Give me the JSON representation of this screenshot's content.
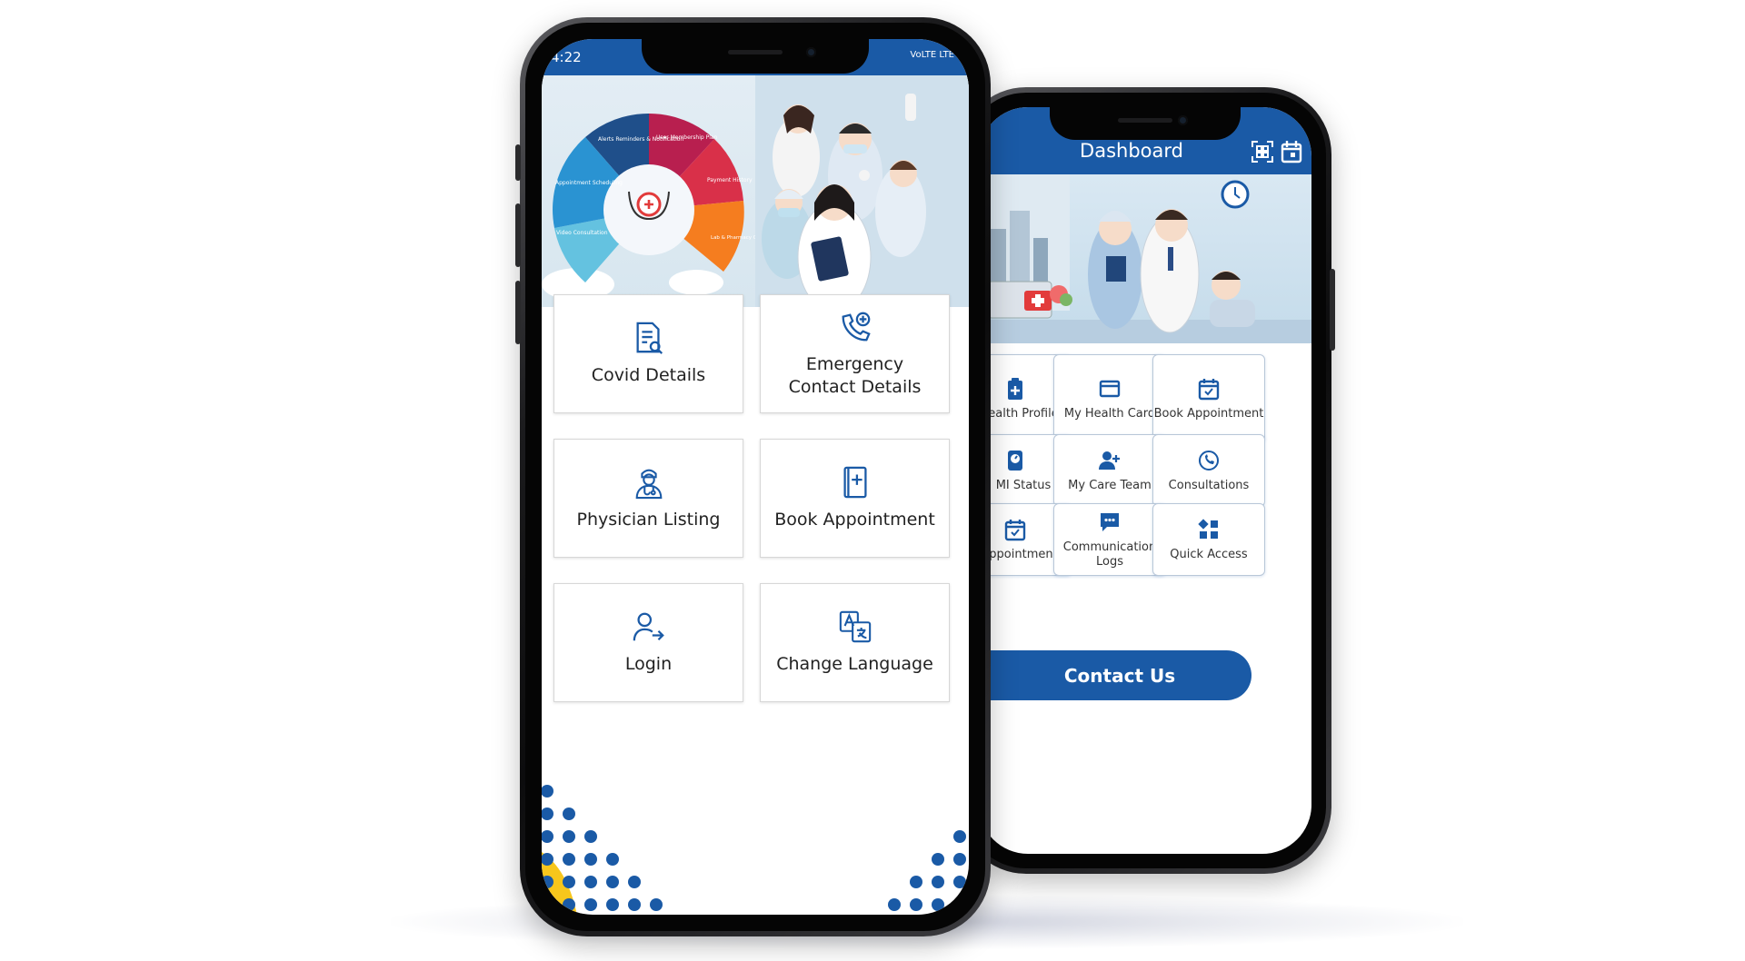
{
  "colors": {
    "primary": "#1a5aa6",
    "tile_border": "#d7d7d7",
    "accent_yellow": "#f7c61c"
  },
  "front_phone": {
    "status": {
      "time": "4:22",
      "network": "VoLTE LTE"
    },
    "banner_wheel": {
      "segments": [
        "Alerts Reminders & Notification",
        "User Membership Plan",
        "Payment History",
        "Lab & Pharmacy Order Management",
        "Video Consultation",
        "Appointment Scheduling"
      ]
    },
    "tiles": [
      {
        "label": "Covid Details",
        "icon": "document-search-icon"
      },
      {
        "label": "Emergency Contact Details",
        "icon": "phone-plus-icon"
      },
      {
        "label": "Physician Listing",
        "icon": "doctor-icon"
      },
      {
        "label": "Book Appointment",
        "icon": "medical-book-icon"
      },
      {
        "label": "Login",
        "icon": "user-login-icon"
      },
      {
        "label": "Change Language",
        "icon": "translate-icon"
      }
    ]
  },
  "back_phone": {
    "header": {
      "title": "Dashboard",
      "icons": [
        "qr-code-icon",
        "calendar-icon"
      ]
    },
    "tiles": [
      {
        "label": "Health Profile",
        "display": "ealth Profile",
        "icon": "clipboard-plus-icon"
      },
      {
        "label": "My Health Card",
        "display": "My Health Card",
        "icon": "card-icon"
      },
      {
        "label": "Book Appointment",
        "display": "Book Appointment",
        "icon": "calendar-check-icon"
      },
      {
        "label": "BMI Status",
        "display": "MI Status",
        "icon": "scale-icon"
      },
      {
        "label": "My Care Team",
        "display": "My Care Team",
        "icon": "team-icon"
      },
      {
        "label": "Consultations",
        "display": "Consultations",
        "icon": "phone-history-icon"
      },
      {
        "label": "Appointment",
        "display": "ppointment",
        "icon": "calendar-check-icon"
      },
      {
        "label": "Communication Logs",
        "display": "Communication Logs",
        "icon": "chat-icon"
      },
      {
        "label": "Quick Access",
        "display": "Quick Access",
        "icon": "grid-icon"
      }
    ],
    "contact_button": "Contact Us"
  }
}
